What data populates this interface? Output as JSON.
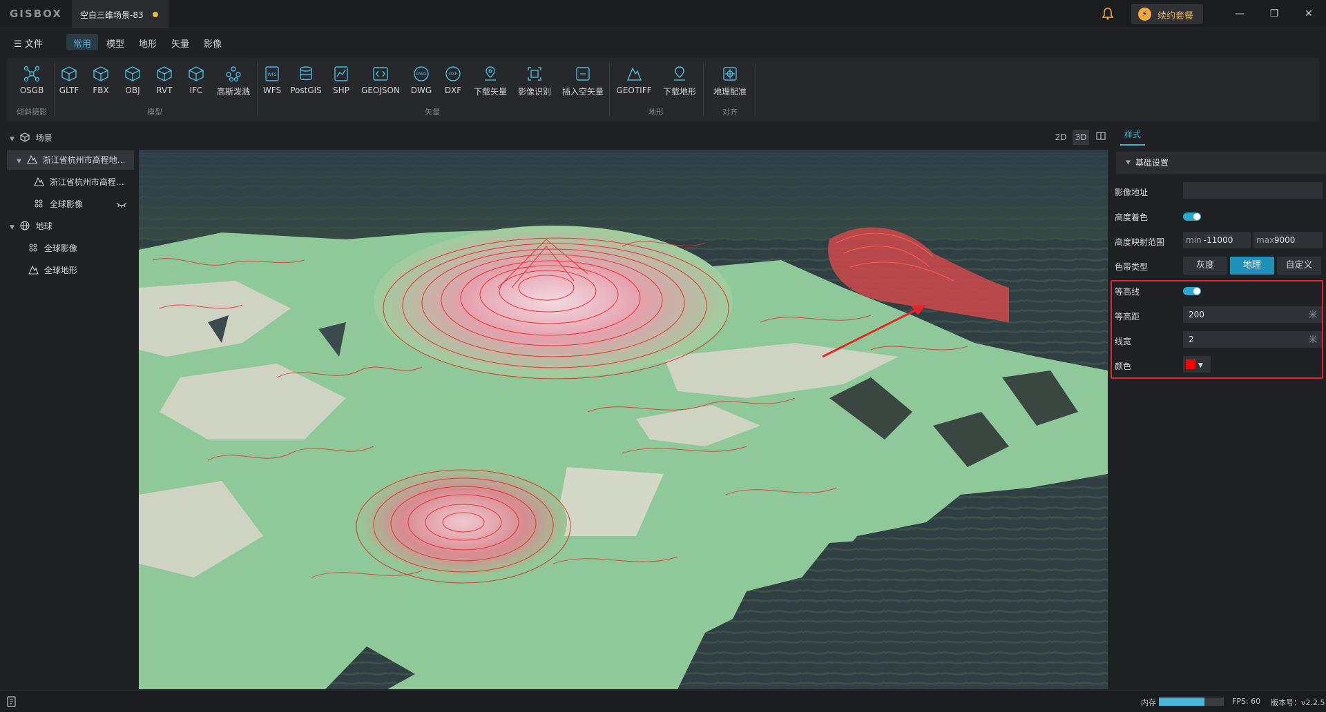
{
  "titlebar": {
    "logo": "GISBOX",
    "document_tab": "空白三维场景-83",
    "renew_label": "续约套餐"
  },
  "menubar": {
    "file": "文件",
    "tabs": [
      {
        "label": "常用",
        "active": true
      },
      {
        "label": "模型",
        "active": false
      },
      {
        "label": "地形",
        "active": false
      },
      {
        "label": "矢量",
        "active": false
      },
      {
        "label": "影像",
        "active": false
      }
    ]
  },
  "ribbon": {
    "groups": [
      {
        "label": "倾斜摄影",
        "tools": [
          "OSGB"
        ]
      },
      {
        "label": "模型",
        "tools": [
          "GLTF",
          "FBX",
          "OBJ",
          "RVT",
          "IFC",
          "高斯泼溅"
        ]
      },
      {
        "label": "矢量",
        "tools": [
          "WFS",
          "PostGIS",
          "SHP",
          "GEOJSON",
          "DWG",
          "DXF",
          "下载矢量",
          "影像识别",
          "插入空矢量"
        ]
      },
      {
        "label": "地形",
        "tools": [
          "GEOTIFF",
          "下载地形"
        ]
      },
      {
        "label": "对齐",
        "tools": [
          "地理配准"
        ]
      }
    ]
  },
  "tree": {
    "scene": "场景",
    "scene_layer": "浙江省杭州市高程地…",
    "scene_child_1": "浙江省杭州市高程…",
    "scene_child_2": "全球影像",
    "earth": "地球",
    "earth_child_1": "全球影像",
    "earth_child_2": "全球地形"
  },
  "view_modes": [
    "2D",
    "3D"
  ],
  "panel": {
    "tab": "样式",
    "section": "基础设置",
    "imagery_url_label": "影像地址",
    "imagery_url_value": "",
    "height_color_label": "高度着色",
    "height_color_on": true,
    "range_label": "高度映射范围",
    "min_tag": "min",
    "min_value": "-11000",
    "max_tag": "max",
    "max_value": "9000",
    "ramp_label": "色带类型",
    "ramp_options": [
      {
        "label": "灰度",
        "active": false
      },
      {
        "label": "地理",
        "active": true
      },
      {
        "label": "自定义",
        "active": false
      }
    ],
    "contour_label": "等高线",
    "contour_on": true,
    "interval_label": "等高距",
    "interval_value": "200",
    "interval_unit": "米",
    "width_label": "线宽",
    "width_value": "2",
    "width_unit": "米",
    "color_label": "颜色",
    "color_value": "#ff0000"
  },
  "status": {
    "memory_label": "内存",
    "memory_fraction": 0.7,
    "fps": "FPS: 60",
    "version": "版本号：v2.2.5"
  },
  "colors": {
    "accent": "#3fb4d6",
    "highlight": "#e2262a",
    "contour": "#e8302c",
    "terrain_low": "#8fc99a",
    "terrain_flat": "#cfd3c2"
  }
}
